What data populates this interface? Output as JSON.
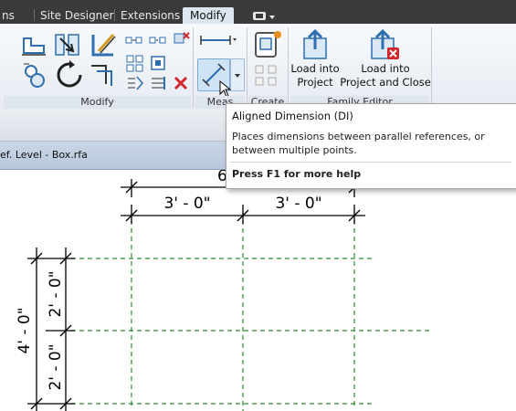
{
  "tabs": {
    "partial_tab": "ns",
    "site_designer": "Site Designer",
    "extensions": "Extensions",
    "modify": "Modify"
  },
  "ribbon": {
    "panels": {
      "modify": "Modify",
      "measure": "Meas",
      "create": "Create",
      "family_editor": "Family Editor"
    },
    "load_into_project": "Load into\nProject",
    "load_into_project_and_close": "Load into\nProject and Close"
  },
  "view": {
    "tab_label": "ef. Level - Box.rfa"
  },
  "drawing": {
    "dim_top_overall": "6",
    "dim_top_left": "3' - 0\"",
    "dim_top_right": "3' - 0\"",
    "dim_left_overall": "4' - 0\"",
    "dim_left_upper": "2' - 0\"",
    "dim_left_lower": "2' - 0\""
  },
  "tooltip": {
    "title": "Aligned Dimension",
    "shortcut": "(DI)",
    "description": "Places dimensions between parallel references, or between multiple points.",
    "help": "Press F1 for more help"
  },
  "colors": {
    "ref_plane": "#2e8b2e",
    "tab_bar": "#3a3a3a",
    "ribbon_accent": "#2f7ec2",
    "delete_red": "#d0262c"
  },
  "icons": [
    "align-icon",
    "split-icon",
    "trim-icon",
    "offset-icon",
    "rotate-icon",
    "copy-icon",
    "mirror-icon",
    "array-icon",
    "scale-icon",
    "pin-icon",
    "unpin-icon",
    "delete-icon",
    "aligned-dimension-icon",
    "dimension-dropdown-icon",
    "create-group-icon",
    "load-into-project-icon",
    "load-into-project-close-icon"
  ]
}
